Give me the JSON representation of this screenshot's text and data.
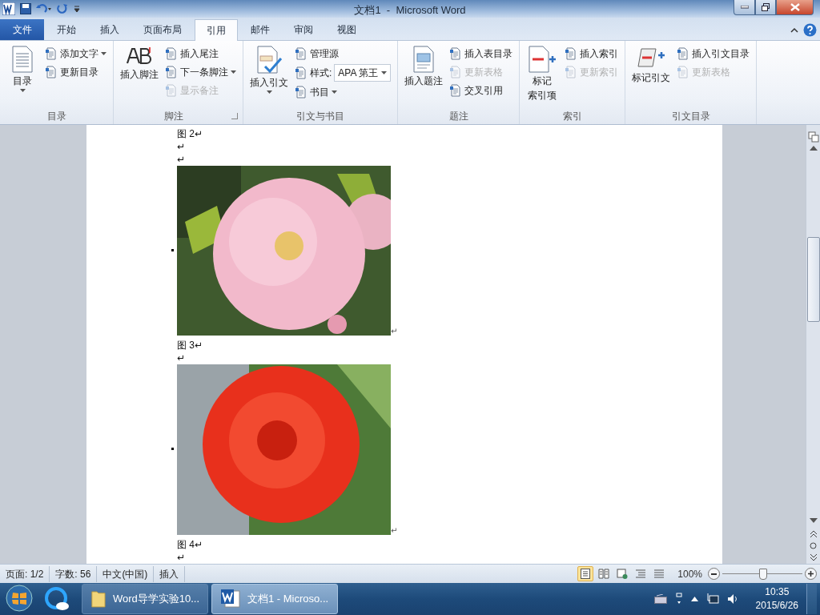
{
  "title_bar": {
    "title": "文档1  -  Microsoft Word"
  },
  "tabs": [
    {
      "label": "文件",
      "kind": "file",
      "selected": false
    },
    {
      "label": "开始",
      "kind": "tab",
      "selected": false
    },
    {
      "label": "插入",
      "kind": "tab",
      "selected": false
    },
    {
      "label": "页面布局",
      "kind": "tab",
      "selected": false
    },
    {
      "label": "引用",
      "kind": "tab",
      "selected": true
    },
    {
      "label": "邮件",
      "kind": "tab",
      "selected": false
    },
    {
      "label": "审阅",
      "kind": "tab",
      "selected": false
    },
    {
      "label": "视图",
      "kind": "tab",
      "selected": false
    }
  ],
  "ribbon_groups": [
    {
      "label": "目录",
      "launcher": false,
      "large": [
        {
          "lines": [
            "目录"
          ],
          "dropdown": true,
          "kind": "toc"
        }
      ],
      "small": [
        {
          "label": "添加文字",
          "dropdown": true,
          "disabled": false,
          "kind": "button"
        },
        {
          "label": "更新目录",
          "dropdown": false,
          "disabled": false,
          "kind": "button"
        }
      ]
    },
    {
      "label": "脚注",
      "launcher": true,
      "large": [
        {
          "lines": [
            "插入脚注"
          ],
          "dropdown": false,
          "kind": "footnote"
        }
      ],
      "small": [
        {
          "label": "插入尾注",
          "dropdown": false,
          "disabled": false,
          "kind": "button"
        },
        {
          "label": "下一条脚注",
          "dropdown": true,
          "disabled": false,
          "kind": "button"
        },
        {
          "label": "显示备注",
          "dropdown": false,
          "disabled": true,
          "kind": "button"
        }
      ]
    },
    {
      "label": "引文与书目",
      "launcher": false,
      "large": [
        {
          "lines": [
            "插入引文"
          ],
          "dropdown": true,
          "kind": "citation"
        }
      ],
      "small": [
        {
          "label": "管理源",
          "dropdown": false,
          "disabled": false,
          "kind": "button"
        },
        {
          "label": "样式:",
          "value": "APA 第王",
          "dropdown": true,
          "kind": "combo"
        },
        {
          "label": "书目",
          "dropdown": true,
          "disabled": false,
          "kind": "button"
        }
      ]
    },
    {
      "label": "题注",
      "launcher": false,
      "large": [
        {
          "lines": [
            "插入题注"
          ],
          "dropdown": false,
          "kind": "caption"
        }
      ],
      "small": [
        {
          "label": "插入表目录",
          "dropdown": false,
          "disabled": false,
          "kind": "button"
        },
        {
          "label": "更新表格",
          "dropdown": false,
          "disabled": true,
          "kind": "button"
        },
        {
          "label": "交叉引用",
          "dropdown": false,
          "disabled": false,
          "kind": "button"
        }
      ]
    },
    {
      "label": "索引",
      "launcher": false,
      "large": [
        {
          "lines": [
            "标记",
            "索引项"
          ],
          "dropdown": false,
          "kind": "mark"
        }
      ],
      "small": [
        {
          "label": "插入索引",
          "dropdown": false,
          "disabled": false,
          "kind": "button"
        },
        {
          "label": "更新索引",
          "dropdown": false,
          "disabled": true,
          "kind": "button"
        }
      ]
    },
    {
      "label": "引文目录",
      "launcher": false,
      "large": [
        {
          "lines": [
            "标记引文"
          ],
          "dropdown": false,
          "kind": "scroll"
        }
      ],
      "small": [
        {
          "label": "插入引文目录",
          "dropdown": false,
          "disabled": false,
          "kind": "button"
        },
        {
          "label": "更新表格",
          "dropdown": false,
          "disabled": true,
          "kind": "button"
        }
      ]
    }
  ],
  "document": [
    {
      "kind": "text",
      "text": "图 2↵"
    },
    {
      "kind": "text",
      "text": "↵"
    },
    {
      "kind": "text",
      "text": "↵"
    },
    {
      "kind": "blossom",
      "mark": "↵"
    },
    {
      "kind": "text",
      "text": "图 3↵"
    },
    {
      "kind": "text",
      "text": "↵"
    },
    {
      "kind": "rose",
      "mark": "↵"
    },
    {
      "kind": "text",
      "text": "图 4↵"
    },
    {
      "kind": "text",
      "text": "↵"
    }
  ],
  "status_bar": {
    "items": [
      "页面: 1/2",
      "字数: 56",
      "中文(中国)",
      "插入"
    ],
    "views": [
      {
        "kind": "print",
        "selected": true
      },
      {
        "kind": "read",
        "selected": false
      },
      {
        "kind": "web",
        "selected": false
      },
      {
        "kind": "outline",
        "selected": false
      },
      {
        "kind": "draft",
        "selected": false
      }
    ],
    "zoom": {
      "reading": "100%",
      "level": 0.5
    }
  },
  "taskbar": {
    "buttons": [
      {
        "label": "Word导学实验10...",
        "kind": "folder",
        "selected": false
      },
      {
        "label": "文档1 - Microso...",
        "kind": "word",
        "selected": true
      }
    ],
    "time": "10:35",
    "date": "2015/6/26"
  }
}
